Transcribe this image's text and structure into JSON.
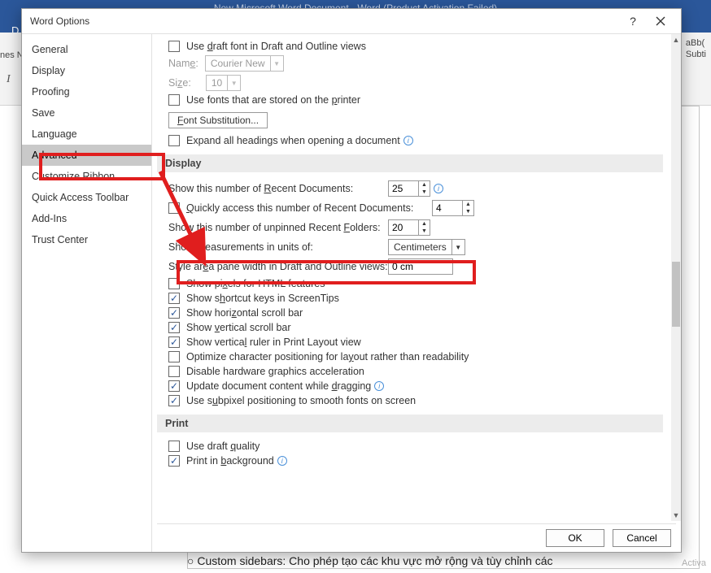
{
  "app_titlebar": "New Microsoft Word Document - Word (Product Activation Failed)",
  "dialog_title": "Word Options",
  "bg": {
    "styles_label1": "aBb(",
    "styles_label2": "Subti",
    "italic": "I",
    "nes": "nes N",
    "d": "D"
  },
  "sidebar": {
    "items": [
      {
        "label": "General"
      },
      {
        "label": "Display"
      },
      {
        "label": "Proofing"
      },
      {
        "label": "Save"
      },
      {
        "label": "Language"
      },
      {
        "label": "Advanced"
      },
      {
        "label": "Customize Ribbon"
      },
      {
        "label": "Quick Access Toolbar"
      },
      {
        "label": "Add-Ins"
      },
      {
        "label": "Trust Center"
      }
    ],
    "selected": 5
  },
  "top_group": {
    "draft_font": "Use draft font in Draft and Outline views",
    "name_label": "Name:",
    "name_value": "Courier New",
    "size_label": "Size:",
    "size_value": "10",
    "use_printer_fonts": "Use fonts that are stored on the printer",
    "font_sub_btn": "Font Substitution...",
    "expand_headings": "Expand all headings when opening a document"
  },
  "display": {
    "header": "Display",
    "recent_docs_label": "Show this number of Recent Documents:",
    "recent_docs_value": "25",
    "quick_access_label": "Quickly access this number of Recent Documents:",
    "quick_access_value": "4",
    "unpinned_folders_label": "Show this number of unpinned Recent Folders:",
    "unpinned_folders_value": "20",
    "measure_label": "Show measurements in units of:",
    "measure_value": "Centimeters",
    "style_area_label": "Style area pane width in Draft and Outline views:",
    "style_area_value": "0 cm",
    "checks": {
      "pixels_html": "Show pixels for HTML features",
      "shortcut_keys": "Show shortcut keys in ScreenTips",
      "hscroll": "Show horizontal scroll bar",
      "vscroll": "Show vertical scroll bar",
      "vruler": "Show vertical ruler in Print Layout view",
      "optimize_char": "Optimize character positioning for layout rather than readability",
      "disable_hw": "Disable hardware graphics acceleration",
      "update_drag": "Update document content while dragging",
      "subpixel": "Use subpixel positioning to smooth fonts on screen"
    }
  },
  "print": {
    "header": "Print",
    "draft_quality": "Use draft quality",
    "print_bg": "Print in background"
  },
  "buttons": {
    "ok": "OK",
    "cancel": "Cancel"
  },
  "page_bottom": "○   Custom sidebars: Cho phép tạo các khu vực mở rộng và tùy chỉnh các",
  "activate": "Activa"
}
